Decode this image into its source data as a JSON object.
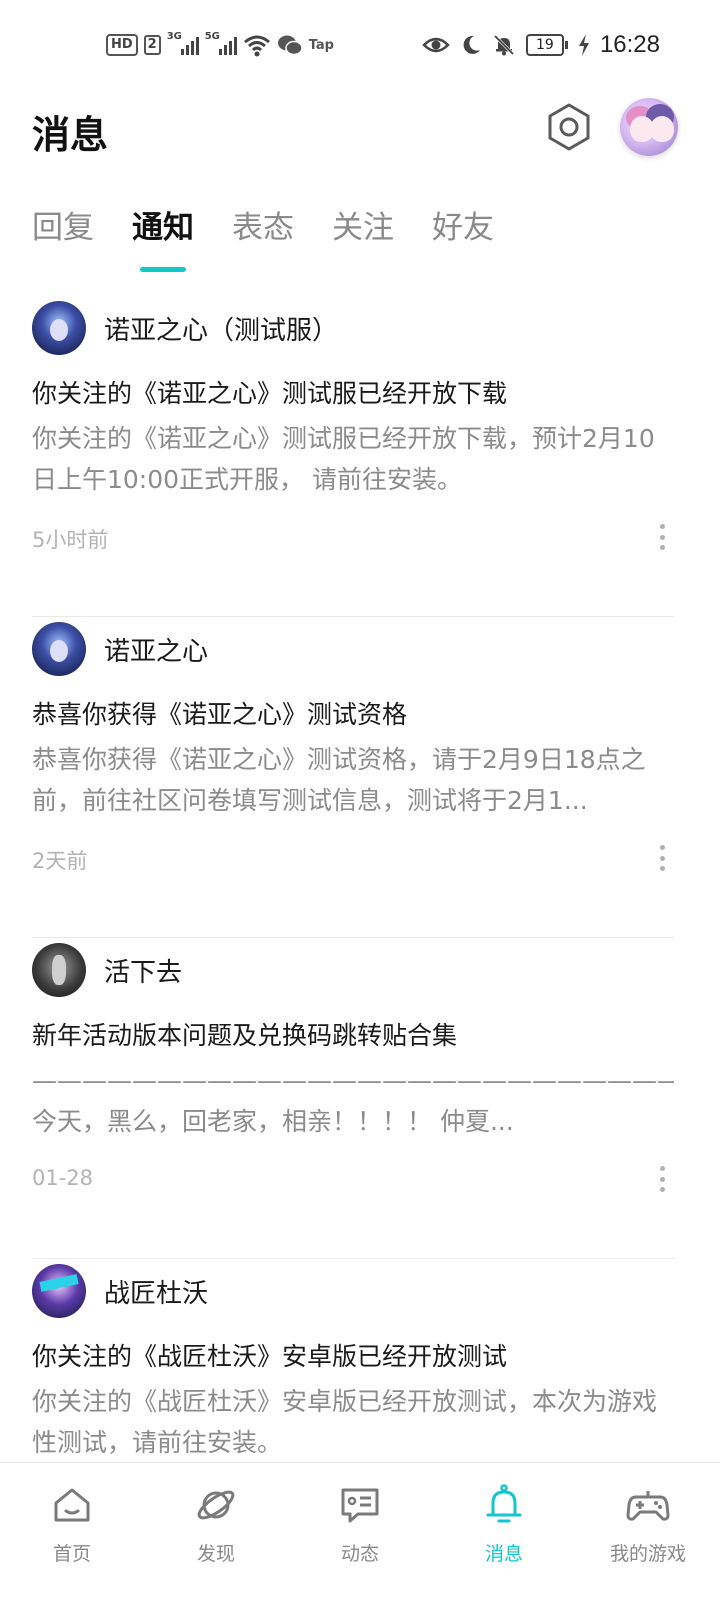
{
  "status_bar": {
    "hd": "HD",
    "sim": "2",
    "signal1": "3G",
    "signal2": "5G",
    "app_label": "Tap",
    "battery": "19",
    "time": "16:28"
  },
  "header": {
    "title": "消息"
  },
  "tabs": [
    {
      "label": "回复",
      "active": false
    },
    {
      "label": "通知",
      "active": true
    },
    {
      "label": "表态",
      "active": false
    },
    {
      "label": "关注",
      "active": false
    },
    {
      "label": "好友",
      "active": false
    }
  ],
  "notifications": [
    {
      "name": "诺亚之心（测试服）",
      "title": "你关注的《诺亚之心》测试服已经开放下载",
      "body": "你关注的《诺亚之心》测试服已经开放下载，预计2月10日上午10:00正式开服， 请前往安装。",
      "time": "5小时前"
    },
    {
      "name": "诺亚之心",
      "title": "恭喜你获得《诺亚之心》测试资格",
      "body": "恭喜你获得《诺亚之心》测试资格，请于2月9日18点之前，前往社区问卷填写测试信息，测试将于2月1...",
      "time": "2天前"
    },
    {
      "name": "活下去",
      "title": "新年活动版本问题及兑换码跳转贴合集",
      "body": "——————————————————————————— 今天，黑么，回老家，相亲！！！！ 仲夏...",
      "time": "01-28"
    },
    {
      "name": "战匠杜沃",
      "title": "你关注的《战匠杜沃》安卓版已经开放测试",
      "body": "你关注的《战匠杜沃》安卓版已经开放测试，本次为游戏性测试，请前往安装。",
      "time": ""
    }
  ],
  "bottom_nav": [
    {
      "label": "首页",
      "icon": "home-icon",
      "active": false
    },
    {
      "label": "发现",
      "icon": "planet-icon",
      "active": false
    },
    {
      "label": "动态",
      "icon": "chat-icon",
      "active": false
    },
    {
      "label": "消息",
      "icon": "bell-icon",
      "active": true
    },
    {
      "label": "我的游戏",
      "icon": "gamepad-icon",
      "active": false
    }
  ],
  "colors": {
    "accent": "#15c5ce",
    "muted": "#8b8b8b"
  }
}
